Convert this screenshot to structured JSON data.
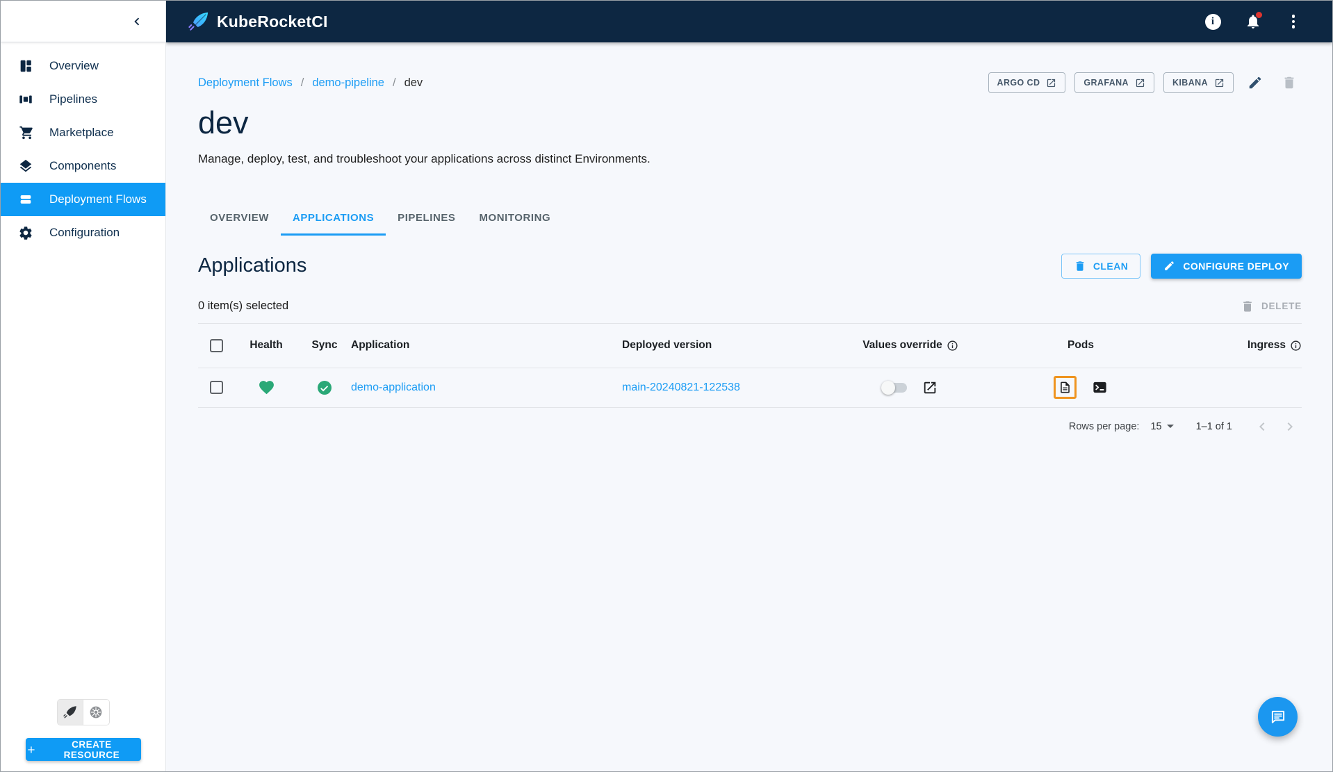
{
  "topbar": {
    "app_title": "KubeRocketCI"
  },
  "sidebar": {
    "items": [
      {
        "label": "Overview",
        "selected": false
      },
      {
        "label": "Pipelines",
        "selected": false
      },
      {
        "label": "Marketplace",
        "selected": false
      },
      {
        "label": "Components",
        "selected": false
      },
      {
        "label": "Deployment Flows",
        "selected": true
      },
      {
        "label": "Configuration",
        "selected": false
      }
    ],
    "create_button_label": "CREATE RESOURCE"
  },
  "breadcrumb": {
    "links": [
      "Deployment Flows",
      "demo-pipeline"
    ],
    "current": "dev",
    "separator": "/"
  },
  "quick_links": [
    {
      "label": "ARGO CD"
    },
    {
      "label": "GRAFANA"
    },
    {
      "label": "KIBANA"
    }
  ],
  "page": {
    "title": "dev",
    "subtitle": "Manage, deploy, test, and troubleshoot your applications across distinct Environments."
  },
  "tabs": [
    {
      "label": "OVERVIEW",
      "active": false
    },
    {
      "label": "APPLICATIONS",
      "active": true
    },
    {
      "label": "PIPELINES",
      "active": false
    },
    {
      "label": "MONITORING",
      "active": false
    }
  ],
  "applications_section": {
    "heading": "Applications",
    "clean_button_label": "CLEAN",
    "configure_deploy_button_label": "CONFIGURE DEPLOY",
    "selection_status": "0 item(s) selected",
    "delete_button_label": "DELETE"
  },
  "table": {
    "columns": [
      "Health",
      "Sync",
      "Application",
      "Deployed version",
      "Values override",
      "Pods",
      "Ingress"
    ],
    "rows": [
      {
        "health": "healthy",
        "sync": "synced",
        "application": "demo-application",
        "deployed_version": "main-20240821-122538",
        "values_override_enabled": false
      }
    ]
  },
  "pagination": {
    "rows_per_page_label": "Rows per page:",
    "rows_per_page_value": "15",
    "range_label": "1–1 of 1"
  },
  "colors": {
    "accent_blue": "#1b9cf4",
    "sidebar_selected_blue": "#0f9bf5",
    "header_navy": "#0d2742",
    "healthy_green": "#2aa877",
    "highlight_orange": "#ef9420",
    "notification_red": "#e0352f"
  }
}
